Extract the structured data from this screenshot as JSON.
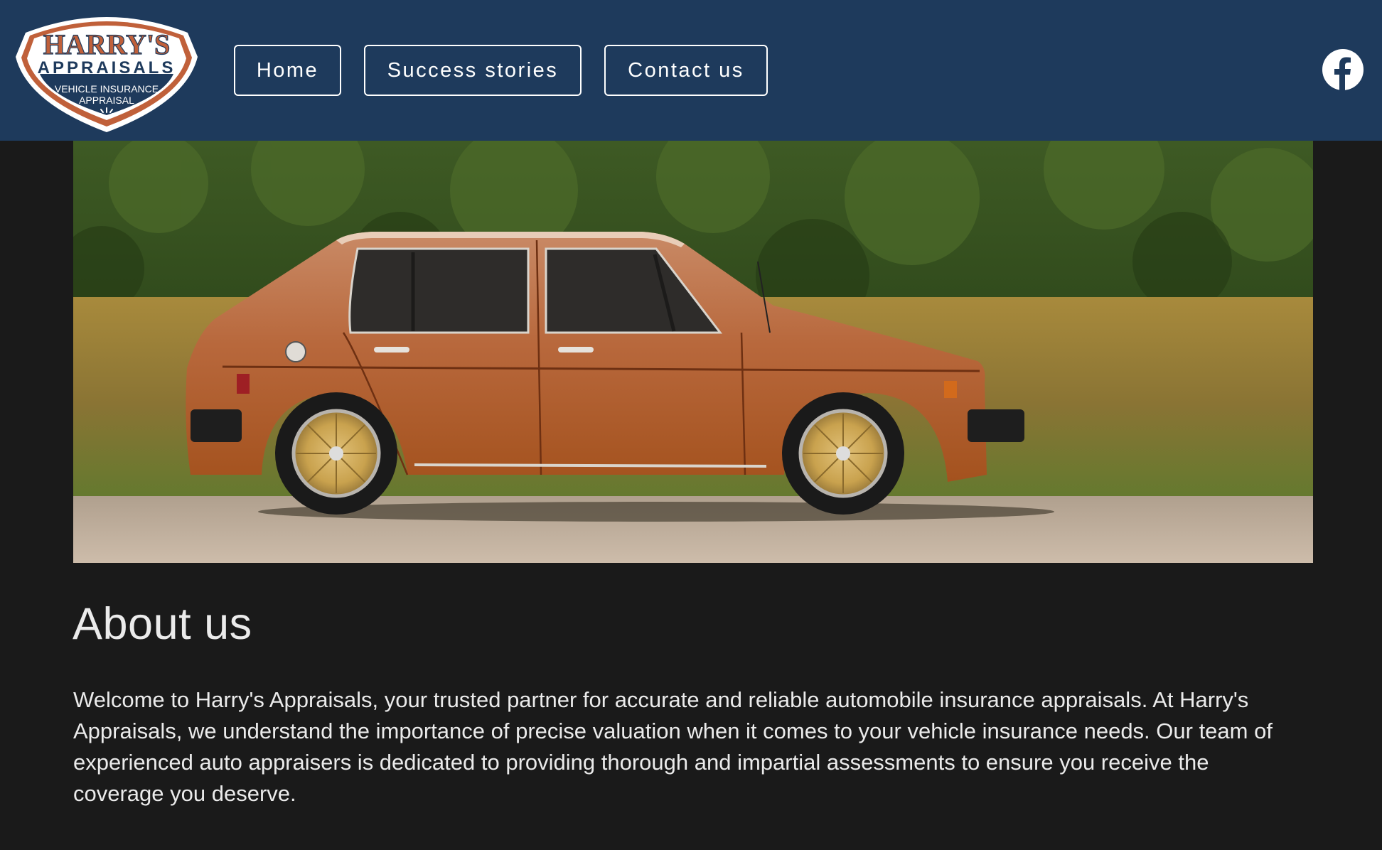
{
  "brand": {
    "logo_line1": "HARRY'S",
    "logo_line2": "APPRAISALS",
    "logo_line3": "VEHICLE INSURANCE",
    "logo_line4": "APPRAISAL",
    "colors": {
      "header": "#1e3a5c",
      "logo_orange": "#c0603a",
      "page_bg": "#1a1a1a"
    }
  },
  "nav": {
    "home": "Home",
    "success": "Success stories",
    "contact": "Contact us"
  },
  "social": {
    "icon": "facebook-icon"
  },
  "hero": {
    "subject": "orange hatchback car"
  },
  "about": {
    "title": "About us",
    "text": "Welcome to Harry's Appraisals, your trusted partner for accurate and reliable automobile insurance appraisals. At Harry's Appraisals, we understand the importance of precise valuation when it comes to your vehicle insurance needs. Our team of experienced auto appraisers is dedicated to providing thorough and impartial assessments to ensure you receive the coverage you deserve."
  }
}
